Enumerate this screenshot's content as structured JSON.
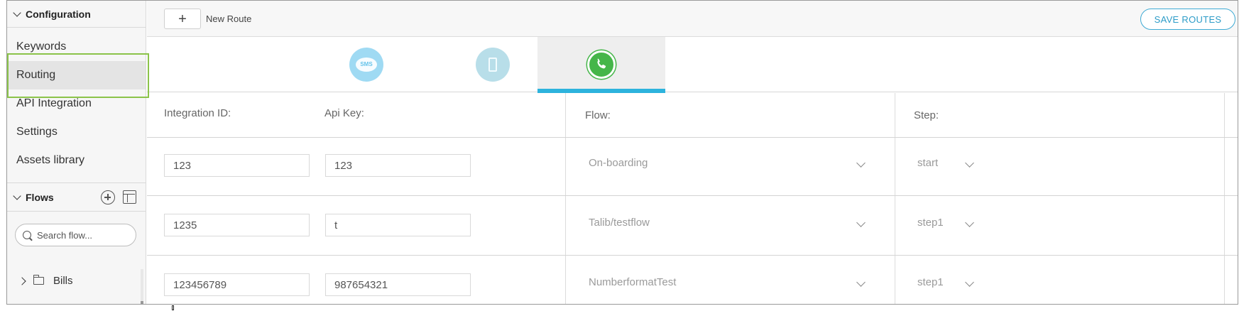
{
  "sidebar": {
    "config_header": "Configuration",
    "items": [
      {
        "label": "Keywords"
      },
      {
        "label": "Routing"
      },
      {
        "label": "API Integration"
      },
      {
        "label": "Settings"
      },
      {
        "label": "Assets library"
      }
    ],
    "flows_header": "Flows",
    "search_placeholder": "Search flow...",
    "tree": [
      {
        "label": "Bills"
      }
    ]
  },
  "toolbar": {
    "add_label": "+",
    "new_route_label": "New Route",
    "save_label": "SAVE ROUTES"
  },
  "channels": [
    {
      "name": "sms",
      "icon": "sms-icon",
      "text": "SMS"
    },
    {
      "name": "voice",
      "icon": "phone-icon"
    },
    {
      "name": "whatsapp",
      "icon": "whatsapp-icon",
      "active": true
    }
  ],
  "table": {
    "headers": {
      "integration_id": "Integration ID:",
      "api_key": "Api Key:",
      "flow": "Flow:",
      "step": "Step:"
    },
    "rows": [
      {
        "integration_id": "123",
        "api_key": "123",
        "flow": "On-boarding",
        "step": "start"
      },
      {
        "integration_id": "1235",
        "api_key": "t",
        "flow": "Talib/testflow",
        "step": "step1"
      },
      {
        "integration_id": "123456789",
        "api_key": "987654321",
        "flow": "NumberformatTest",
        "step": "step1"
      }
    ]
  },
  "colors": {
    "accent": "#2db3dd",
    "highlight": "#8bc34a",
    "whatsapp": "#45b649"
  }
}
